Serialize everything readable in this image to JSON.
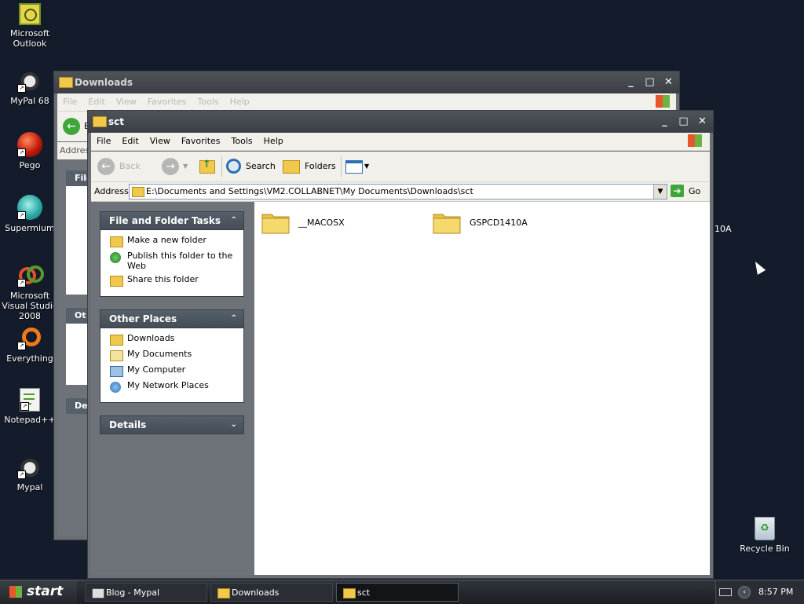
{
  "desktop": {
    "icons": [
      {
        "label": "Microsoft\nOutlook"
      },
      {
        "label": "MyPal 68"
      },
      {
        "label": "Pego"
      },
      {
        "label": "Supermium"
      },
      {
        "label": "Microsoft Visual Studio 2008"
      },
      {
        "label": "Everything"
      },
      {
        "label": "Notepad++"
      },
      {
        "label": "Mypal"
      },
      {
        "label": "Recycle Bin"
      }
    ],
    "behind_text": "10A"
  },
  "window_back": {
    "title": "Downloads",
    "menu": [
      "File",
      "Edit",
      "View",
      "Favorites",
      "Tools",
      "Help"
    ],
    "back_label": "B",
    "address_label": "Addres",
    "pane_heads": [
      "File",
      "Ot",
      "De"
    ]
  },
  "window_sct": {
    "title": "sct",
    "menu": [
      "File",
      "Edit",
      "View",
      "Favorites",
      "Tools",
      "Help"
    ],
    "toolbar": {
      "back": "Back",
      "search": "Search",
      "folders": "Folders"
    },
    "address": {
      "label": "Address",
      "value": "E:\\Documents and Settings\\VM2.COLLABNET\\My Documents\\Downloads\\sct",
      "go": "Go"
    },
    "tasks": {
      "title": "File and Folder Tasks",
      "items": [
        "Make a new folder",
        "Publish this folder to the Web",
        "Share this folder"
      ]
    },
    "places": {
      "title": "Other Places",
      "items": [
        "Downloads",
        "My Documents",
        "My Computer",
        "My Network Places"
      ]
    },
    "details": {
      "title": "Details"
    },
    "files": [
      "__MACOSX",
      "GSPCD1410A"
    ]
  },
  "taskbar": {
    "start": "start",
    "tasks": [
      "Blog - Mypal",
      "Downloads",
      "sct"
    ],
    "clock": "8:57 PM"
  }
}
